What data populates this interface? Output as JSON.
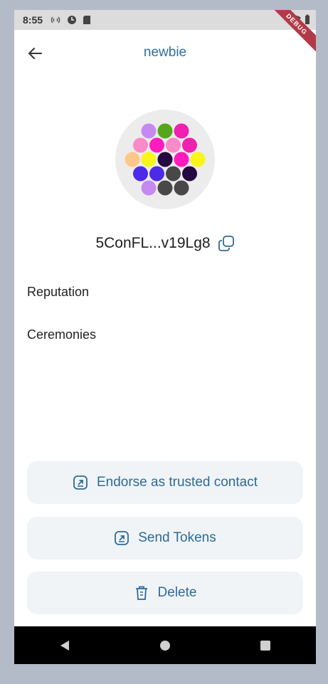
{
  "status_bar": {
    "time": "8:55",
    "debug_label": "DEBUG"
  },
  "app_bar": {
    "title": "newbie"
  },
  "identity": {
    "address": "5ConFL...v19Lg8"
  },
  "sections": {
    "reputation": "Reputation",
    "ceremonies": "Ceremonies"
  },
  "actions": {
    "endorse": "Endorse as trusted contact",
    "send": "Send Tokens",
    "delete": "Delete"
  },
  "colors": {
    "accent": "#2e6a98",
    "button_bg": "#f0f4f7",
    "avatar_dots": [
      "#c58af0",
      "#55a61c",
      "#f020b0",
      "#f98ac8",
      "#ff1bbe",
      "#f98ac8",
      "#f020b0",
      "#fcc88a",
      "#f8f51a",
      "#250941",
      "#ff1bbe",
      "#f8f51a",
      "#4c2ae8",
      "#4c2ae8",
      "#484848",
      "#250941",
      "#c58af0",
      "#484848",
      "#484848"
    ]
  },
  "icons": {
    "back": "arrow-left-icon",
    "copy": "copy-icon",
    "endorse": "external-link-square-icon",
    "send": "external-link-square-icon",
    "delete": "trash-icon"
  }
}
